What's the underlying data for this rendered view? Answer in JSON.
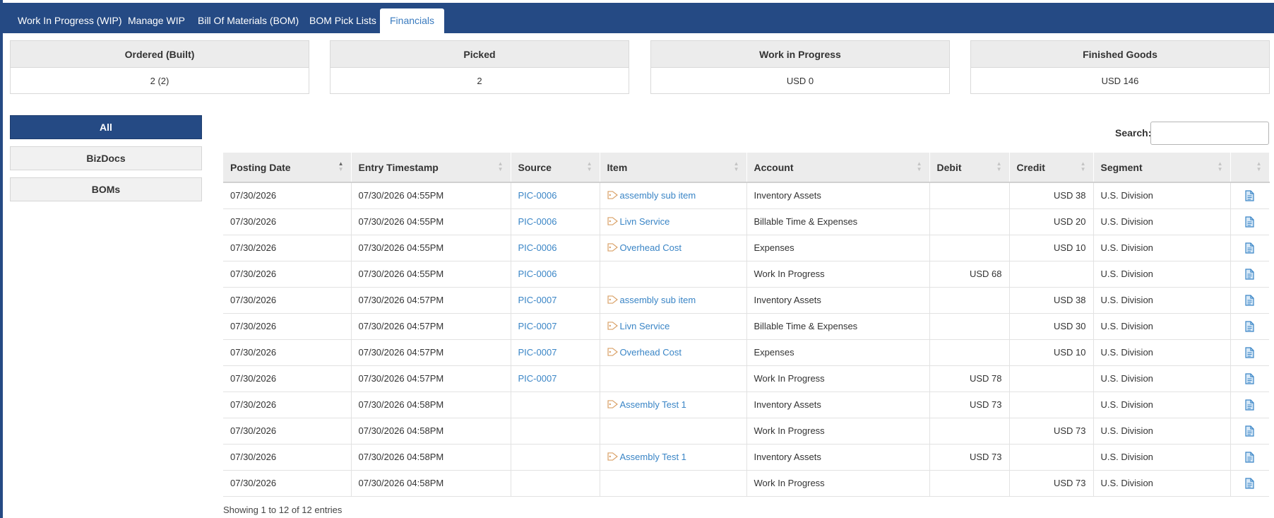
{
  "tabs": [
    {
      "label": "Work In Progress (WIP)"
    },
    {
      "label": "Manage WIP"
    },
    {
      "label": "Bill Of Materials (BOM)"
    },
    {
      "label": "BOM Pick Lists"
    },
    {
      "label": "Financials"
    }
  ],
  "stats": [
    {
      "title": "Ordered (Built)",
      "value": "2 (2)"
    },
    {
      "title": "Picked",
      "value": "2"
    },
    {
      "title": "Work in Progress",
      "value": "USD 0"
    },
    {
      "title": "Finished Goods",
      "value": "USD 146"
    }
  ],
  "filters": [
    {
      "label": "All",
      "active": true
    },
    {
      "label": "BizDocs",
      "active": false
    },
    {
      "label": "BOMs",
      "active": false
    }
  ],
  "search": {
    "label": "Search:",
    "value": ""
  },
  "table": {
    "columns": [
      "Posting Date",
      "Entry Timestamp",
      "Source",
      "Item",
      "Account",
      "Debit",
      "Credit",
      "Segment",
      ""
    ],
    "rows": [
      {
        "posting_date": "07/30/2026",
        "timestamp": "07/30/2026 04:55PM",
        "source": "PIC-0006",
        "item": "assembly sub item",
        "account": "Inventory Assets",
        "debit": "",
        "credit": "USD 38",
        "segment": "U.S. Division"
      },
      {
        "posting_date": "07/30/2026",
        "timestamp": "07/30/2026 04:55PM",
        "source": "PIC-0006",
        "item": "Livn Service",
        "account": "Billable Time & Expenses",
        "debit": "",
        "credit": "USD 20",
        "segment": "U.S. Division"
      },
      {
        "posting_date": "07/30/2026",
        "timestamp": "07/30/2026 04:55PM",
        "source": "PIC-0006",
        "item": "Overhead Cost",
        "account": "Expenses",
        "debit": "",
        "credit": "USD 10",
        "segment": "U.S. Division"
      },
      {
        "posting_date": "07/30/2026",
        "timestamp": "07/30/2026 04:55PM",
        "source": "PIC-0006",
        "item": "",
        "account": "Work In Progress",
        "debit": "USD 68",
        "credit": "",
        "segment": "U.S. Division"
      },
      {
        "posting_date": "07/30/2026",
        "timestamp": "07/30/2026 04:57PM",
        "source": "PIC-0007",
        "item": "assembly sub item",
        "account": "Inventory Assets",
        "debit": "",
        "credit": "USD 38",
        "segment": "U.S. Division"
      },
      {
        "posting_date": "07/30/2026",
        "timestamp": "07/30/2026 04:57PM",
        "source": "PIC-0007",
        "item": "Livn Service",
        "account": "Billable Time & Expenses",
        "debit": "",
        "credit": "USD 30",
        "segment": "U.S. Division"
      },
      {
        "posting_date": "07/30/2026",
        "timestamp": "07/30/2026 04:57PM",
        "source": "PIC-0007",
        "item": "Overhead Cost",
        "account": "Expenses",
        "debit": "",
        "credit": "USD 10",
        "segment": "U.S. Division"
      },
      {
        "posting_date": "07/30/2026",
        "timestamp": "07/30/2026 04:57PM",
        "source": "PIC-0007",
        "item": "",
        "account": "Work In Progress",
        "debit": "USD 78",
        "credit": "",
        "segment": "U.S. Division"
      },
      {
        "posting_date": "07/30/2026",
        "timestamp": "07/30/2026 04:58PM",
        "source": "",
        "item": "Assembly Test 1",
        "account": "Inventory Assets",
        "debit": "USD 73",
        "credit": "",
        "segment": "U.S. Division"
      },
      {
        "posting_date": "07/30/2026",
        "timestamp": "07/30/2026 04:58PM",
        "source": "",
        "item": "",
        "account": "Work In Progress",
        "debit": "",
        "credit": "USD 73",
        "segment": "U.S. Division"
      },
      {
        "posting_date": "07/30/2026",
        "timestamp": "07/30/2026 04:58PM",
        "source": "",
        "item": "Assembly Test 1",
        "account": "Inventory Assets",
        "debit": "USD 73",
        "credit": "",
        "segment": "U.S. Division"
      },
      {
        "posting_date": "07/30/2026",
        "timestamp": "07/30/2026 04:58PM",
        "source": "",
        "item": "",
        "account": "Work In Progress",
        "debit": "",
        "credit": "USD 73",
        "segment": "U.S. Division"
      }
    ],
    "info": "Showing 1 to 12 of 12 entries"
  },
  "icons": {
    "item_tag": "tag-icon",
    "row_action": "document-icon",
    "sort": "sort-arrows-icon"
  },
  "colors": {
    "header": "#254a84",
    "link": "#3a85c6",
    "active_filter": "#254a84"
  }
}
